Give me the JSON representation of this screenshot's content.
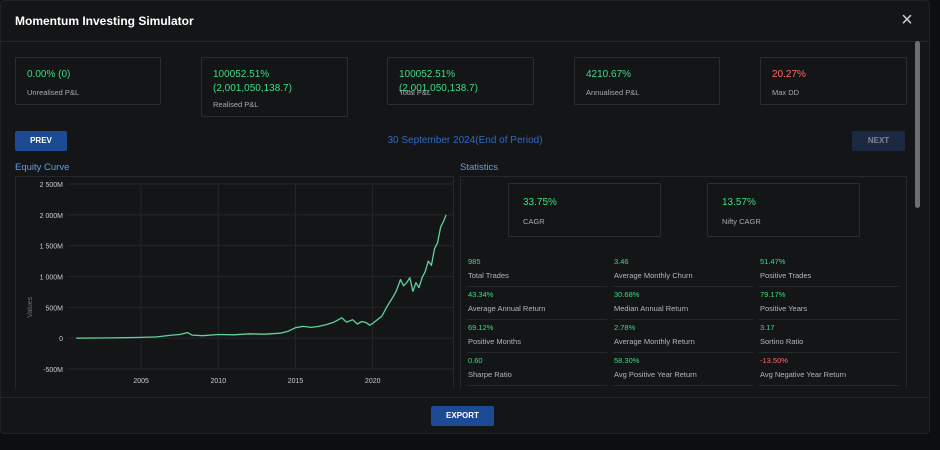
{
  "title": "Momentum Investing Simulator",
  "close_icon": "×",
  "cards": [
    {
      "value": "0.00% (0)",
      "label": "Unrealised P&L",
      "color": "green"
    },
    {
      "value": "100052.51%\n(2,001,050,138.7)",
      "label": "Realised P&L",
      "color": "green"
    },
    {
      "value": "100052.51%\n(2,001,050,138.7)",
      "label": "Total P&L",
      "color": "green"
    },
    {
      "value": "4210.67%",
      "label": "Annualised P&L",
      "color": "green"
    },
    {
      "value": "20.27%",
      "label": "Max DD",
      "color": "red"
    }
  ],
  "nav": {
    "prev": "PREV",
    "next": "NEXT",
    "period": "30 September 2024(End of Period)"
  },
  "equity_title": "Equity Curve",
  "statistics_title": "Statistics",
  "stat_cards": [
    {
      "value": "33.75%",
      "label": "CAGR"
    },
    {
      "value": "13.57%",
      "label": "Nifty CAGR"
    }
  ],
  "stats": [
    {
      "value": "985",
      "label": "Total Trades",
      "color": "green"
    },
    {
      "value": "3.46",
      "label": "Average Monthly Churn",
      "color": "green"
    },
    {
      "value": "51.47%",
      "label": "Positive Trades",
      "color": "green"
    },
    {
      "value": "43.34%",
      "label": "Average Annual Return",
      "color": "green"
    },
    {
      "value": "30.68%",
      "label": "Median Annual Return",
      "color": "green"
    },
    {
      "value": "79.17%",
      "label": "Positive Years",
      "color": "green"
    },
    {
      "value": "69.12%",
      "label": "Positive Months",
      "color": "green"
    },
    {
      "value": "2.78%",
      "label": "Average Monthly Return",
      "color": "green"
    },
    {
      "value": "3.17",
      "label": "Sortino Ratio",
      "color": "green"
    },
    {
      "value": "0.60",
      "label": "Sharpe Ratio",
      "color": "green"
    },
    {
      "value": "58.30%",
      "label": "Avg Positive Year Return",
      "color": "green"
    },
    {
      "value": "-13.50%",
      "label": "Avg Negative Year Return",
      "color": "red"
    }
  ],
  "export_label": "EXPORT",
  "colors": {
    "accent": "#1c4a95",
    "positive": "#3ddc84",
    "negative": "#ff6b6b",
    "line": "#5fd39a"
  },
  "chart_data": {
    "type": "line",
    "title": "Equity Curve",
    "xlabel": "",
    "ylabel": "Values",
    "x_ticks": [
      "2005",
      "2010",
      "2015",
      "2020"
    ],
    "y_ticks": [
      "2 500M",
      "2 000M",
      "1 500M",
      "1 000M",
      "500M",
      "0",
      "-500M"
    ],
    "xlim": [
      2000.2,
      2025.2
    ],
    "ylim": [
      -500,
      2500
    ],
    "grid": true,
    "series": [
      {
        "x": [
          2000.8,
          2002,
          2003,
          2004,
          2005,
          2006,
          2006.5,
          2007,
          2007.5,
          2008,
          2008.3,
          2009,
          2010,
          2011,
          2012,
          2013,
          2014,
          2014.5,
          2015,
          2015.5,
          2016,
          2016.5,
          2017,
          2017.5,
          2018,
          2018.3,
          2018.7,
          2019,
          2019.3,
          2019.6,
          2019.8,
          2020,
          2020.3,
          2020.6,
          2020.9,
          2021.2,
          2021.5,
          2021.8,
          2022,
          2022.2,
          2022.4,
          2022.6,
          2022.8,
          2023,
          2023.2,
          2023.4,
          2023.6,
          2023.8,
          2024,
          2024.2,
          2024.4,
          2024.6,
          2024.75
        ],
        "y": [
          0,
          2,
          5,
          8,
          12,
          20,
          35,
          50,
          60,
          90,
          50,
          40,
          60,
          55,
          70,
          65,
          80,
          110,
          170,
          190,
          175,
          190,
          220,
          260,
          330,
          260,
          300,
          230,
          270,
          250,
          210,
          240,
          300,
          360,
          500,
          620,
          750,
          950,
          850,
          900,
          980,
          760,
          900,
          820,
          980,
          1080,
          1250,
          1180,
          1450,
          1550,
          1800,
          1900,
          2000
        ]
      }
    ]
  }
}
